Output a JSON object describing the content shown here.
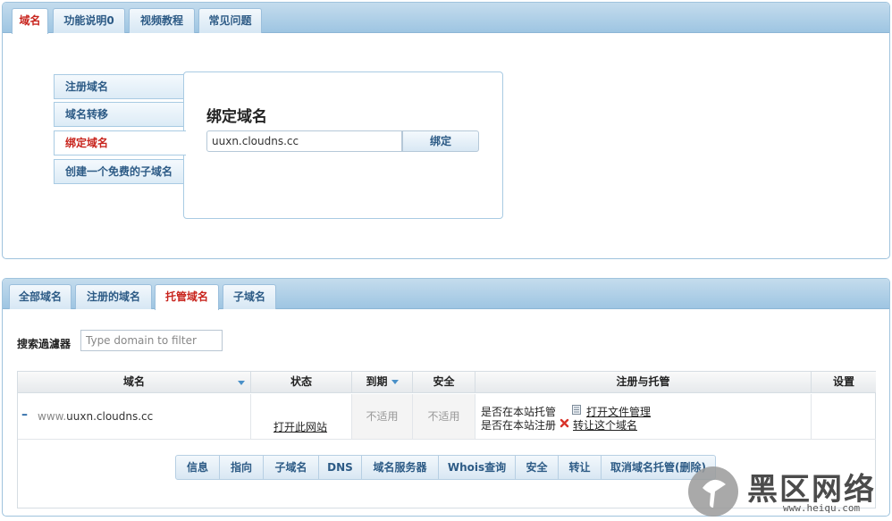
{
  "top_tabs": [
    {
      "label": "域名"
    },
    {
      "label": "功能说明0"
    },
    {
      "label": "视频教程"
    },
    {
      "label": "常见问题"
    }
  ],
  "side_menu": [
    {
      "label": "注册域名"
    },
    {
      "label": "域名转移"
    },
    {
      "label": "绑定域名"
    },
    {
      "label": "创建一个免费的子域名"
    }
  ],
  "bind_panel": {
    "title": "绑定域名",
    "input_value": "uuxn.cloudns.cc",
    "button_label": "绑定"
  },
  "bottom_tabs": [
    {
      "label": "全部域名"
    },
    {
      "label": "注册的域名"
    },
    {
      "label": "托管域名"
    },
    {
      "label": "子域名"
    }
  ],
  "filter": {
    "label": "搜索過濾器",
    "placeholder": "Type domain to filter"
  },
  "table": {
    "headers": {
      "domain": "域名",
      "status": "状态",
      "expiry": "到期",
      "security": "安全",
      "registration": "注册与托管",
      "settings": "设置"
    },
    "row": {
      "expand": "–",
      "domain_prefix": "www.",
      "domain": "uuxn.cloudns.cc",
      "open_site": "打开此网站",
      "expiry": "不适用",
      "security": "不适用",
      "hosted_label": "是否在本站托管",
      "file_manager": "打开文件管理",
      "registered_label": "是否在本站注册",
      "transfer": "转让这个域名"
    },
    "actions": [
      "信息",
      "指向",
      "子域名",
      "DNS",
      "域名服务器",
      "Whois查询",
      "安全",
      "转让",
      "取消域名托管(删除)"
    ]
  },
  "watermark": {
    "text": "黑区网络",
    "url": "www.heiqu.com"
  },
  "colors": {
    "active_tab_text": "#c8251e",
    "tab_text": "#2d5b86",
    "tabbar_bg": "#9ec5e2",
    "sort_arrow": "#4a90c8",
    "delete_icon": "#d9342b"
  }
}
